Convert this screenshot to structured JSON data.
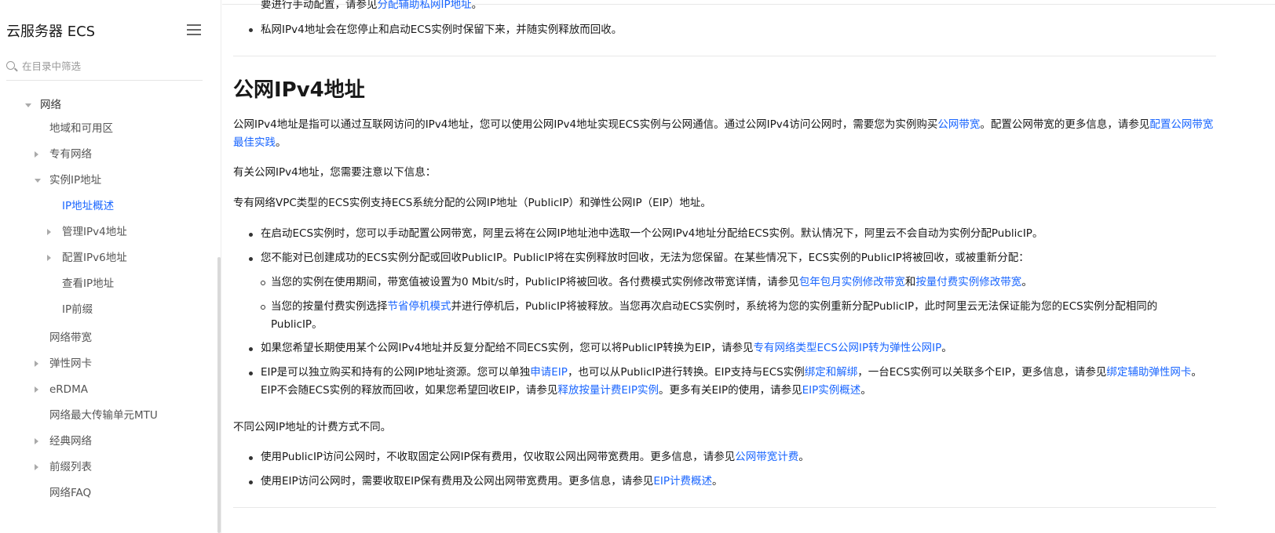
{
  "sidebar": {
    "title": "云服务器 ECS",
    "search_placeholder": "在目录中筛选",
    "items": [
      {
        "label": "网络"
      },
      {
        "label": "地域和可用区"
      },
      {
        "label": "专有网络"
      },
      {
        "label": "实例IP地址"
      },
      {
        "label": "IP地址概述"
      },
      {
        "label": "管理IPv4地址"
      },
      {
        "label": "配置IPv6地址"
      },
      {
        "label": "查看IP地址"
      },
      {
        "label": "IP前缀"
      },
      {
        "label": "网络带宽"
      },
      {
        "label": "弹性网卡"
      },
      {
        "label": "eRDMA"
      },
      {
        "label": "网络最大传输单元MTU"
      },
      {
        "label": "经典网络"
      },
      {
        "label": "前缀列表"
      },
      {
        "label": "网络FAQ"
      }
    ]
  },
  "content": {
    "top_clipped": {
      "t1": "要进行手动配置，请参见",
      "l1": "分配辅助私网IP地址",
      "t2": "。"
    },
    "top_bullet": "私网IPv4地址会在您停止和启动ECS实例时保留下来，并随实例释放而回收。",
    "heading": "公网IPv4地址",
    "intro": {
      "t1": "公网IPv4地址是指可以通过互联网访问的IPv4地址，您可以使用公网IPv4地址实现ECS实例与公网通信。通过公网IPv4访问公网时，需要您为实例购买",
      "l1": "公网带宽",
      "t2": "。配置公网带宽的更多信息，请参见",
      "l2": "配置公网带宽最佳实践",
      "t3": "。"
    },
    "note_intro": "有关公网IPv4地址，您需要注意以下信息：",
    "vpc_line": "专有网络VPC类型的ECS实例支持ECS系统分配的公网IP地址（PublicIP）和弹性公网IP（EIP）地址。",
    "b1": "在启动ECS实例时，您可以手动配置公网带宽，阿里云将在公网IP地址池中选取一个公网IPv4地址分配给ECS实例。默认情况下，阿里云不会自动为实例分配PublicIP。",
    "b2": "您不能对已创建成功的ECS实例分配或回收PublicIP。PublicIP将在实例释放时回收，无法为您保留。在某些情况下，ECS实例的PublicIP将被回收，或被重新分配：",
    "s1": {
      "t1": "当您的实例在使用期间，带宽值被设置为0 Mbit/s时，PublicIP将被回收。各付费模式实例修改带宽详情，请参见",
      "l1": "包年包月实例修改带宽",
      "t2": "和",
      "l2": "按量付费实例修改带宽",
      "t3": "。"
    },
    "s2": {
      "t1": "当您的按量付费实例选择",
      "l1": "节省停机模式",
      "t2": "并进行停机后，PublicIP将被释放。当您再次启动ECS实例时，系统将为您的实例重新分配PublicIP，此时阿里云无法保证能为您的ECS实例分配相同的PublicIP。"
    },
    "b3": {
      "t1": "如果您希望长期使用某个公网IPv4地址并反复分配给不同ECS实例，您可以将PublicIP转换为EIP，请参见",
      "l1": "专有网络类型ECS公网IP转为弹性公网IP",
      "t2": "。"
    },
    "b4": {
      "t1": "EIP是可以独立购买和持有的公网IP地址资源。您可以单独",
      "l1": "申请EIP",
      "t2": "，也可以从PublicIP进行转换。EIP支持与ECS实例",
      "l2": "绑定和解绑",
      "t3": "，一台ECS实例可以关联多个EIP，更多信息，请参见",
      "l3": "绑定辅助弹性网卡",
      "t4": "。EIP不会随ECS实例的释放而回收，如果您希望回收EIP，请参见",
      "l4": "释放按量计费EIP实例",
      "t5": "。更多有关EIP的使用，请参见",
      "l5": "EIP实例概述",
      "t6": "。"
    },
    "billing_intro": "不同公网IP地址的计费方式不同。",
    "c1": {
      "t1": "使用PublicIP访问公网时，不收取固定公网IP保有费用，仅收取公网出网带宽费用。更多信息，请参见",
      "l1": "公网带宽计费",
      "t2": "。"
    },
    "c2": {
      "t1": "使用EIP访问公网时，需要收取EIP保有费用及公网出网带宽费用。更多信息，请参见",
      "l1": "EIP计费概述",
      "t2": "。"
    }
  }
}
